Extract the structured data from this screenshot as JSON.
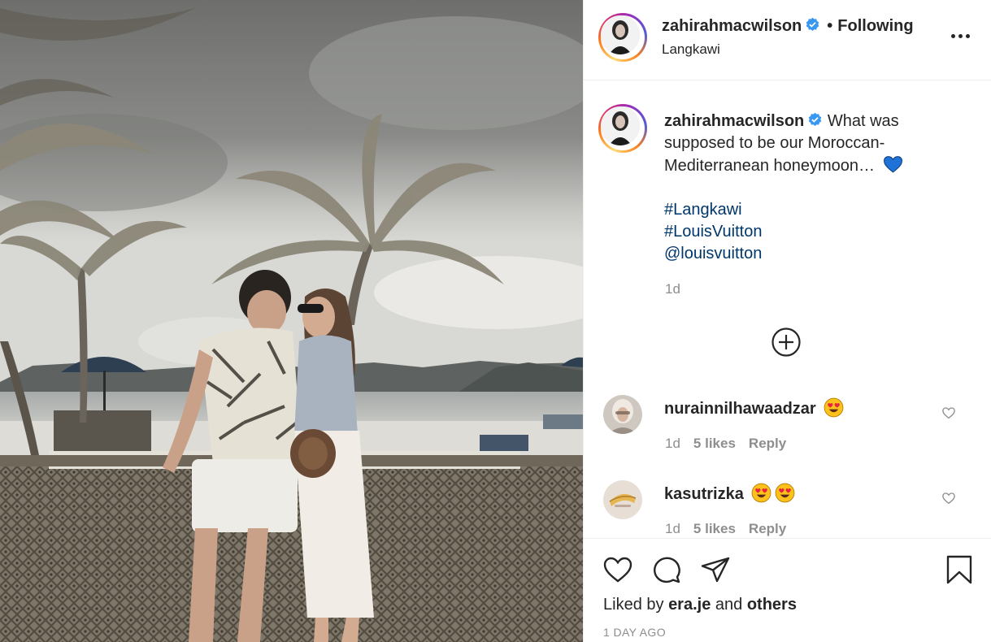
{
  "post": {
    "username": "zahirahmacwilson",
    "verified": true,
    "follow_status": "Following",
    "separator": "•",
    "location": "Langkawi",
    "more_icon": "more-horizontal-icon"
  },
  "caption": {
    "username": "zahirahmacwilson",
    "text": "What was supposed to be our Moroccan-Mediterranean honeymoon…",
    "emoji": "blue-heart-emoji",
    "hashtags": [
      "#Langkawi",
      "#LouisVuitton"
    ],
    "mention": "@louisvuitton",
    "time": "1d",
    "load_more_icon": "plus-circle-icon"
  },
  "comments": [
    {
      "username": "nurainnilhawaadzar",
      "emojis": [
        "heart-eyes-emoji"
      ],
      "time": "1d",
      "likes": "5 likes",
      "reply": "Reply"
    },
    {
      "username": "kasutrizka",
      "emojis": [
        "heart-eyes-emoji",
        "heart-eyes-emoji"
      ],
      "time": "1d",
      "likes": "5 likes",
      "reply": "Reply"
    }
  ],
  "actions": {
    "liked_by_prefix": "Liked by",
    "liked_by_user": "era.je",
    "liked_by_and": "and",
    "liked_by_others": "others",
    "timestamp": "1 DAY AGO"
  },
  "colors": {
    "text": "#262626",
    "muted": "#8e8e8e",
    "link": "#00376b",
    "verified": "#3897f0",
    "border": "#efefef",
    "heart_blue": "#1f73d8"
  }
}
